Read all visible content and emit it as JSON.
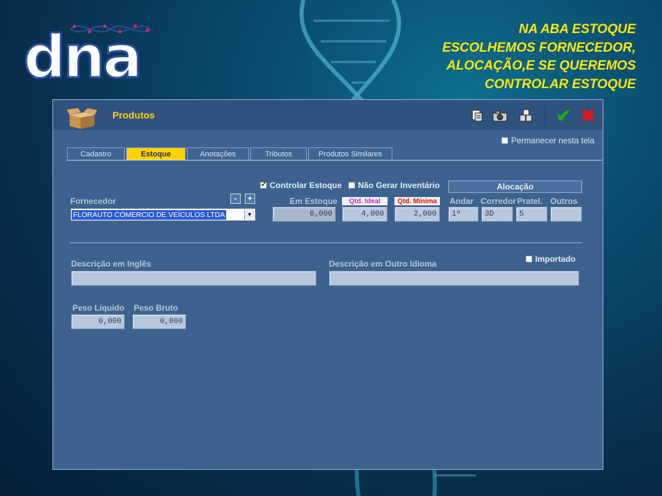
{
  "caption": {
    "lines": [
      "NA ABA ESTOQUE",
      "ESCOLHEMOS FORNECEDOR,",
      "ALOCAÇÃO,E SE QUEREMOS",
      "CONTROLAR ESTOQUE"
    ]
  },
  "logo": {
    "text": "dna"
  },
  "window": {
    "title": "Produtos",
    "toolbar": {
      "icons": [
        "clipboard-icon",
        "camera-icon",
        "boxes-icon",
        "confirm-check-icon",
        "close-x-icon"
      ],
      "confirm_glyph": "✔",
      "close_glyph": "✖"
    },
    "keep_on_screen": {
      "label": "Permanecer nesta tela",
      "checked": false
    },
    "tabs": [
      {
        "label": "Cadastro",
        "active": false
      },
      {
        "label": "Estoque",
        "active": true
      },
      {
        "label": "Anotações",
        "active": false
      },
      {
        "label": "Tributos",
        "active": false
      },
      {
        "label": "Produtos Similares",
        "active": false
      }
    ],
    "estoque": {
      "controlar_estoque": {
        "label": "Controlar Estoque",
        "checked": true
      },
      "nao_gerar_inventario": {
        "label": "Não Gerar Inventário",
        "checked": false
      },
      "fornecedor": {
        "label": "Fornecedor",
        "value": "FLORAUTO COMERCIO DE VEÍCULOS LTDA",
        "minus": "-",
        "plus": "+"
      },
      "em_estoque": {
        "label": "Em Estoque",
        "value": "6,000"
      },
      "qtd_ideal": {
        "label": "Qtd. Ideal",
        "value": "4,000",
        "color": "#d81bd8"
      },
      "qtd_minima": {
        "label": "Qtd. Mínima",
        "value": "2,000",
        "color": "#e01010"
      },
      "alocacao": {
        "header": "Alocação",
        "andar": {
          "label": "Andar",
          "value": "1º"
        },
        "corredor": {
          "label": "Corredor",
          "value": "3D"
        },
        "prateleira": {
          "label": "Pratel.",
          "value": "5"
        },
        "outros": {
          "label": "Outros",
          "value": ""
        }
      },
      "importado": {
        "label": "Importado",
        "checked": false
      },
      "descricao_ingles": {
        "label": "Descrição em Inglês",
        "value": ""
      },
      "descricao_outro": {
        "label": "Descrição em Outro Idioma",
        "value": ""
      },
      "peso_liquido": {
        "label": "Peso Líquido",
        "value": "0,000"
      },
      "peso_bruto": {
        "label": "Peso Bruto",
        "value": "0,000"
      }
    }
  },
  "colors": {
    "caption": "#ffe800",
    "title": "#ffd400",
    "active_tab": "#ffd200",
    "window_bg": "#3d628f"
  }
}
